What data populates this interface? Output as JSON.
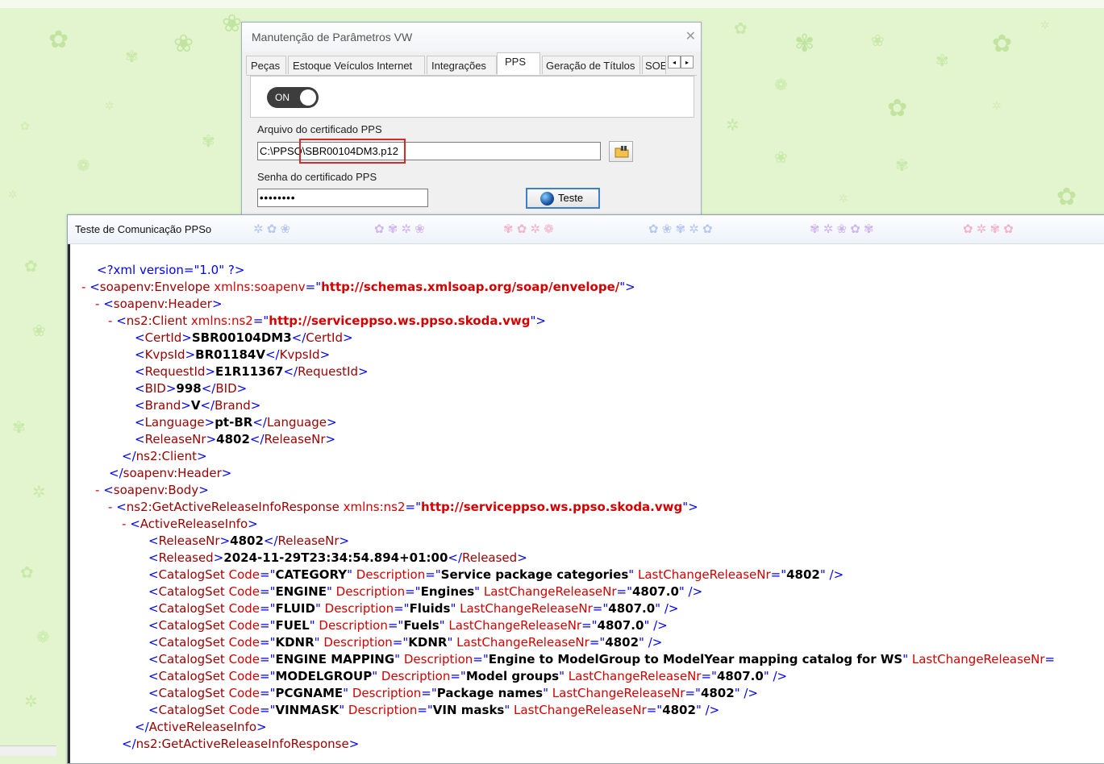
{
  "settings_window": {
    "title": "Manutenção de Parâmetros VW",
    "close_icon": "close-icon",
    "tabs": [
      {
        "label": "Peças",
        "active": false
      },
      {
        "label": "Estoque Veículos Internet",
        "active": false
      },
      {
        "label": "Integrações",
        "active": false
      },
      {
        "label": "PPS",
        "active": true
      },
      {
        "label": "Geração de Títulos",
        "active": false
      },
      {
        "label": "SOE",
        "active": false
      }
    ],
    "tab_scroll_left": "◂",
    "tab_scroll_right": "▸",
    "toggle_label": "ON",
    "cert_file_label": "Arquivo do certificado PPS",
    "cert_file_value": "C:\\PPSO\\SBR00104DM3.p12",
    "cert_password_label": "Senha do certificado PPS",
    "cert_password_value": "••••••••",
    "test_button_label": "Teste"
  },
  "result_window": {
    "title": "Teste de Comunicação PPSo",
    "xml": {
      "declaration": "<?xml version=\"1.0\" ?>",
      "envelope_ns_value": "http://schemas.xmlsoap.org/soap/envelope/",
      "client_ns_value": "http://serviceppso.ws.ppso.skoda.vwg",
      "cert_id": "SBR00104DM3",
      "kvps_id": "BR01184V",
      "request_id": "E1R11367",
      "bid": "998",
      "brand": "V",
      "language": "pt-BR",
      "release_nr": "4802",
      "response_ns_value": "http://serviceppso.ws.ppso.skoda.vwg",
      "active_release_nr": "4802",
      "released": "2024-11-29T23:34:54.894+01:00",
      "catalog_sets": [
        {
          "code": "CATEGORY",
          "description": "Service package categories",
          "last_change": "4802",
          "tail": "\" />"
        },
        {
          "code": "ENGINE",
          "description": "Engines",
          "last_change": "4807.0",
          "tail": "\" />"
        },
        {
          "code": "FLUID",
          "description": "Fluids",
          "last_change": "4807.0",
          "tail": "\" />"
        },
        {
          "code": "FUEL",
          "description": "Fuels",
          "last_change": "4807.0",
          "tail": "\" />"
        },
        {
          "code": "KDNR",
          "description": "KDNR",
          "last_change": "4802",
          "tail": "\" />"
        },
        {
          "code": "ENGINE MAPPING",
          "description": "Engine to ModelGroup to ModelYear mapping catalog for WS",
          "last_change": "",
          "tail": ""
        },
        {
          "code": "MODELGROUP",
          "description": "Model groups",
          "last_change": "4807.0",
          "tail": "\" />"
        },
        {
          "code": "PCGNAME",
          "description": "Package names",
          "last_change": "4802",
          "tail": "\" />"
        },
        {
          "code": "VINMASK",
          "description": "VIN masks",
          "last_change": "4802",
          "tail": "\" />"
        }
      ]
    }
  }
}
